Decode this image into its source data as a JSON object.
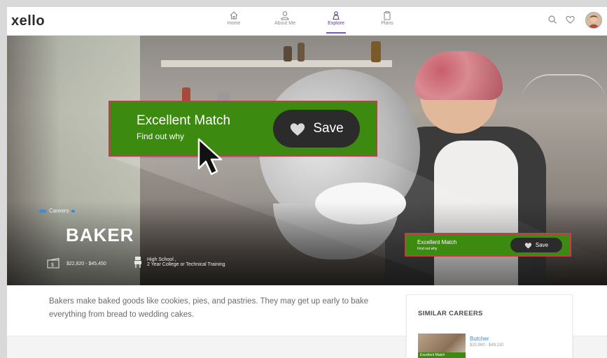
{
  "app": {
    "logo": "xello"
  },
  "nav": {
    "items": [
      {
        "label": "Home",
        "icon": "home-icon"
      },
      {
        "label": "About Me",
        "icon": "person-icon"
      },
      {
        "label": "Explore",
        "icon": "explore-icon",
        "active": true
      },
      {
        "label": "Plans",
        "icon": "clipboard-icon"
      }
    ],
    "right_icons": [
      "search-icon",
      "heart-icon",
      "avatar"
    ]
  },
  "hero": {
    "category": "Careers",
    "title": "BAKER",
    "facts": [
      {
        "icon": "money-icon",
        "text": "$22,820 - $45,450"
      },
      {
        "icon": "education-icon",
        "line1": "High School ,",
        "line2": "2 Year College or Technical Training"
      }
    ]
  },
  "match_banner_large": {
    "title": "Excellent Match",
    "subtitle": "Find out why",
    "save_label": "Save"
  },
  "match_banner_small": {
    "title": "Excellent Match",
    "subtitle": "Find out why",
    "save_label": "Save"
  },
  "description": "Bakers make baked goods like cookies, pies, and pastries. They may get up early to bake everything from bread to wedding cakes.",
  "similar_careers": {
    "heading": "SIMILAR CAREERS",
    "items": [
      {
        "name": "Butcher",
        "salary": "$20,900 - $49,110",
        "badge": "Excellent Match"
      }
    ]
  },
  "colors": {
    "match_green": "#3d8a10",
    "highlight_red": "#c93a4f",
    "save_dark": "#2b2b2b",
    "link_blue": "#3c8ad8",
    "explore_purple": "#7b56b5"
  }
}
